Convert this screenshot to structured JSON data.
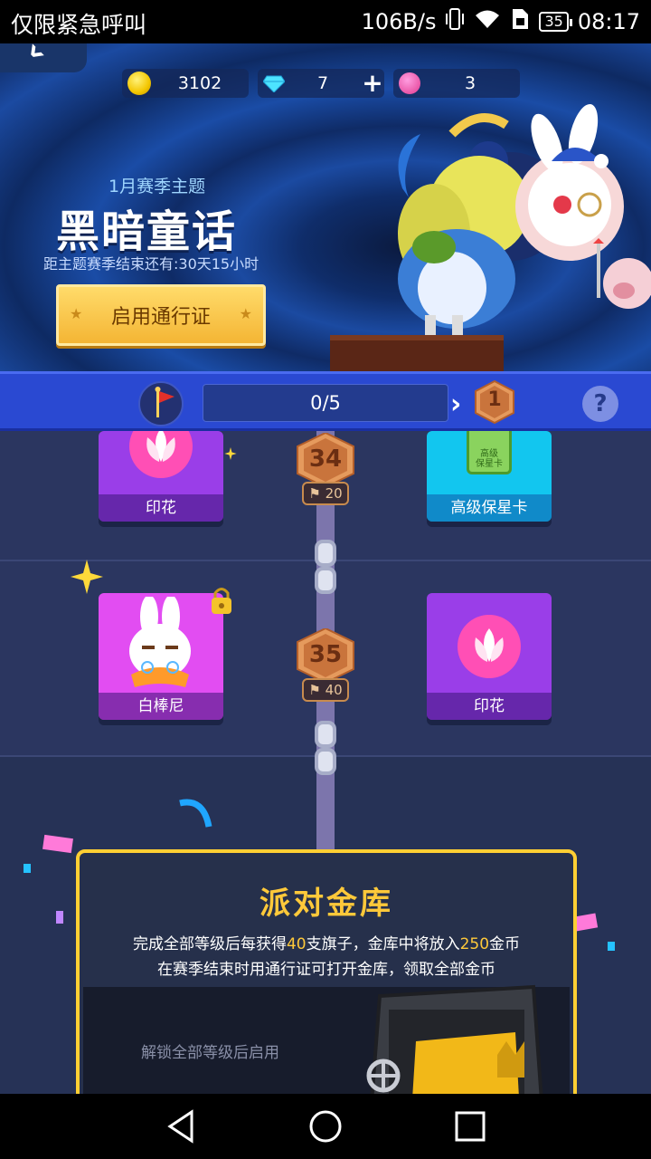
{
  "status_bar": {
    "carrier": "仅限紧急呼叫",
    "net_speed": "106B/s",
    "battery": "35",
    "time": "08:17",
    "icons": [
      "vibrate-icon",
      "wifi-icon",
      "sim-icon",
      "battery-icon"
    ]
  },
  "banner": {
    "currency": {
      "coins": "3102",
      "diamonds": "7",
      "tickets": "3",
      "plus_label": "+"
    },
    "season_subtitle": "1月赛季主题",
    "season_title": "黑暗童话",
    "countdown": "距主题赛季结束还有:30天15小时",
    "pass_button": "启用通行证"
  },
  "progress": {
    "flags": "0/5",
    "next_level": "1",
    "help": "?"
  },
  "levels": [
    {
      "level": "34",
      "flags": "20",
      "left_reward": "印花",
      "right_reward": "高级保星卡",
      "right_icon_text": "高级\n保星卡"
    },
    {
      "level": "35",
      "flags": "40",
      "left_reward": "白棒尼",
      "right_reward": "印花",
      "left_locked": true
    }
  ],
  "vault": {
    "title": "派对金库",
    "line1_a": "完成全部等级后每获得",
    "line1_flags": "40",
    "line1_b": "支旗子，金库中将放入",
    "line1_coins": "250",
    "line1_c": "金币",
    "line2": "在赛季结束时用通行证可打开金库，领取全部金币",
    "locked_text": "解锁全部等级后启用"
  },
  "colors": {
    "accent_gold": "#ffc93a",
    "strip_blue": "#2a49d2",
    "card_purple": "#9a3ee8",
    "card_cyan": "#12c6ef"
  }
}
